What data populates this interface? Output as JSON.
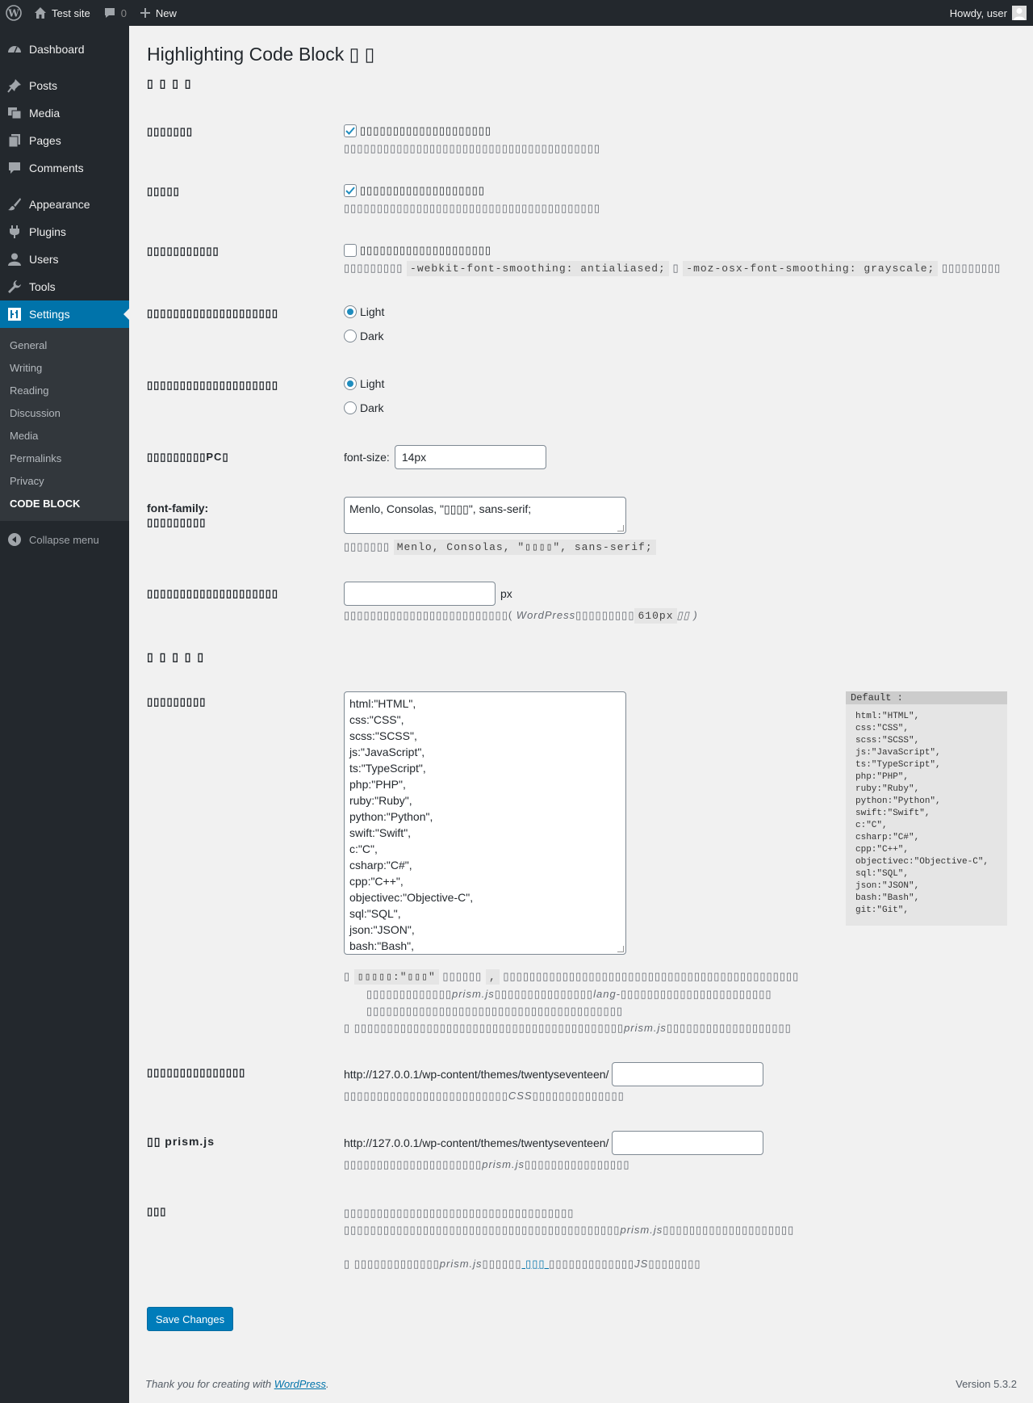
{
  "adminbar": {
    "site_name": "Test site",
    "comments_count": "0",
    "new_label": "New",
    "howdy": "Howdy, user"
  },
  "sidebar": {
    "items": [
      {
        "label": "Dashboard",
        "icon": "dashboard-icon"
      },
      {
        "label": "Posts",
        "icon": "pin-icon"
      },
      {
        "label": "Media",
        "icon": "media-icon"
      },
      {
        "label": "Pages",
        "icon": "page-icon"
      },
      {
        "label": "Comments",
        "icon": "comment-icon"
      },
      {
        "label": "Appearance",
        "icon": "brush-icon"
      },
      {
        "label": "Plugins",
        "icon": "plugin-icon"
      },
      {
        "label": "Users",
        "icon": "user-icon"
      },
      {
        "label": "Tools",
        "icon": "wrench-icon"
      },
      {
        "label": "Settings",
        "icon": "settings-icon"
      }
    ],
    "submenu": [
      "General",
      "Writing",
      "Reading",
      "Discussion",
      "Media",
      "Permalinks",
      "Privacy",
      "CODE BLOCK"
    ],
    "collapse_label": "Collapse menu"
  },
  "page": {
    "title": "Highlighting Code Block ▯ ▯",
    "section1": "▯ ▯ ▯ ▯",
    "section2": "▯ ▯ ▯ ▯ ▯"
  },
  "rows": {
    "r1": {
      "label": "▯▯▯▯▯▯▯",
      "checkbox_label": "▯▯▯▯▯▯▯▯▯▯▯▯▯▯▯▯▯▯▯▯",
      "desc": "▯▯▯▯▯▯▯▯▯▯▯▯▯▯▯▯▯▯▯▯▯▯▯▯▯▯▯▯▯▯▯▯▯▯▯▯▯▯▯",
      "checked": true
    },
    "r2": {
      "label": "▯▯▯▯▯",
      "checkbox_label": "▯▯▯▯▯▯▯▯▯▯▯▯▯▯▯▯▯▯▯",
      "desc": "▯▯▯▯▯▯▯▯▯▯▯▯▯▯▯▯▯▯▯▯▯▯▯▯▯▯▯▯▯▯▯▯▯▯▯▯▯▯▯",
      "checked": true
    },
    "r3": {
      "label": "▯▯▯▯▯▯▯▯▯▯▯",
      "checkbox_label": "▯▯▯▯▯▯▯▯▯▯▯▯▯▯▯▯▯▯▯▯",
      "desc_pre": "▯▯▯▯▯▯▯▯▯",
      "code1": "-webkit-font-smoothing: antialiased;",
      "desc_mid": "▯",
      "code2": "-moz-osx-font-smoothing: grayscale;",
      "desc_post": "▯▯▯▯▯▯▯▯▯",
      "checked": false
    },
    "r4": {
      "label": "▯▯▯▯▯▯▯▯▯▯▯▯▯▯▯▯▯▯▯▯",
      "opt1": "Light",
      "opt2": "Dark",
      "selected": "Light"
    },
    "r5": {
      "label": "▯▯▯▯▯▯▯▯▯▯▯▯▯▯▯▯▯▯▯▯",
      "opt1": "Light",
      "opt2": "Dark",
      "selected": "Light"
    },
    "r6": {
      "label": "▯▯▯▯▯▯▯▯▯PC▯",
      "prefix": "font-size:",
      "value": "14px"
    },
    "r7": {
      "label": "font-family:",
      "label2": "▯▯▯▯▯▯▯▯▯",
      "value": "Menlo, Consolas, \"▯▯▯▯\", sans-serif;",
      "desc_pre": "▯▯▯▯▯▯▯",
      "code": "Menlo, Consolas, \"▯▯▯▯\", sans-serif;"
    },
    "r8": {
      "label": "▯▯▯▯▯▯▯▯▯▯▯▯▯▯▯▯▯▯▯▯",
      "value": "",
      "unit": "px",
      "desc_pre": "▯▯▯▯▯▯▯▯▯▯▯▯▯▯▯▯▯▯▯▯▯▯▯▯▯( ",
      "desc_wp": "WordPress",
      "desc_mid": "▯▯▯▯▯▯▯▯▯",
      "code": "610px",
      "desc_post": "▯▯ )"
    },
    "r9": {
      "label": "▯▯▯▯▯▯▯▯▯",
      "languages": [
        "html:\"HTML\",",
        "css:\"CSS\",",
        "scss:\"SCSS\",",
        "js:\"JavaScript\",",
        "ts:\"TypeScript\",",
        "php:\"PHP\",",
        "ruby:\"Ruby\",",
        "python:\"Python\",",
        "swift:\"Swift\",",
        "c:\"C\",",
        "csharp:\"C#\",",
        "cpp:\"C++\",",
        "objectivec:\"Objective-C\",",
        "sql:\"SQL\",",
        "json:\"JSON\",",
        "bash:\"Bash\","
      ],
      "default_header": "Default :",
      "default_list": [
        "html:\"HTML\",",
        "css:\"CSS\",",
        "scss:\"SCSS\",",
        "js:\"JavaScript\",",
        "ts:\"TypeScript\",",
        "php:\"PHP\",",
        "ruby:\"Ruby\",",
        "python:\"Python\",",
        "swift:\"Swift\",",
        "c:\"C\",",
        "csharp:\"C#\",",
        "cpp:\"C++\",",
        "objectivec:\"Objective-C\",",
        "sql:\"SQL\",",
        "json:\"JSON\",",
        "bash:\"Bash\",",
        "git:\"Git\","
      ],
      "note1_pre": "▯ ",
      "note1_code": "▯▯▯▯▯:\"▯▯▯\"",
      "note1_mid": " ▯▯▯▯▯▯ ",
      "note1_code2": ",",
      "note1_post": " ▯▯▯▯▯▯▯▯▯▯▯▯▯▯▯▯▯▯▯▯▯▯▯▯▯▯▯▯▯▯▯▯▯▯▯▯▯▯▯▯▯▯▯▯▯",
      "note2_pre": "▯▯▯▯▯▯▯▯▯▯▯▯▯",
      "note2_i": "prism.js",
      "note2_mid": "▯▯▯▯▯▯▯▯▯▯▯▯▯▯▯",
      "note2_i2": "lang-",
      "note2_post": "▯▯▯▯▯▯▯▯▯▯▯▯▯▯▯▯▯▯▯▯▯▯▯",
      "note3": "▯▯▯▯▯▯▯▯▯▯▯▯▯▯▯▯▯▯▯▯▯▯▯▯▯▯▯▯▯▯▯▯▯▯▯▯▯▯▯",
      "note4_pre": "▯ ▯▯▯▯▯▯▯▯▯▯▯▯▯▯▯▯▯▯▯▯▯▯▯▯▯▯▯▯▯▯▯▯▯▯▯▯▯▯▯▯▯",
      "note4_i": "prism.js",
      "note4_post": "▯▯▯▯▯▯▯▯▯▯▯▯▯▯▯▯▯▯▯"
    },
    "r10": {
      "label": "▯▯▯▯▯▯▯▯▯▯▯▯▯▯▯",
      "url": "http://127.0.0.1/wp-content/themes/twentyseventeen/",
      "value": "",
      "desc_pre": "▯▯▯▯▯▯▯▯▯▯▯▯▯▯▯▯▯▯▯▯▯▯▯▯▯",
      "desc_i": "CSS",
      "desc_post": "▯▯▯▯▯▯▯▯▯▯▯▯▯▯"
    },
    "r11": {
      "label": "▯▯ prism.js",
      "url": "http://127.0.0.1/wp-content/themes/twentyseventeen/",
      "value": "",
      "desc_pre": "▯▯▯▯▯▯▯▯▯▯▯▯▯▯▯▯▯▯▯▯▯",
      "desc_i": "prism.js",
      "desc_post": "▯▯▯▯▯▯▯▯▯▯▯▯▯▯▯▯"
    },
    "r12": {
      "label": "▯▯▯",
      "line1": "▯▯▯▯▯▯▯▯▯▯▯▯▯▯▯▯▯▯▯▯▯▯▯▯▯▯▯▯▯▯▯▯▯▯▯",
      "line2_pre": "▯▯▯▯▯▯▯▯▯▯▯▯▯▯▯▯▯▯▯▯▯▯▯▯▯▯▯▯▯▯▯▯▯▯▯▯▯▯▯▯▯▯",
      "line2_i": "prism.js",
      "line2_post": "▯▯▯▯▯▯▯▯▯▯▯▯▯▯▯▯▯▯▯▯",
      "line3_pre": "▯ ▯▯▯▯▯▯▯▯▯▯▯▯▯",
      "line3_i": "prism.js",
      "line3_mid": "▯▯▯▯▯▯",
      "line3_link": " ▯▯▯ ",
      "line3_post": "▯▯▯▯▯▯▯▯▯▯▯▯▯",
      "line3_i2": "JS",
      "line3_end": "▯▯▯▯▯▯▯▯"
    }
  },
  "save_label": "Save Changes",
  "footer": {
    "thanks_pre": "Thank you for creating with ",
    "thanks_link": "WordPress",
    "thanks_post": ".",
    "version": "Version 5.3.2"
  },
  "colors": {
    "accent": "#0073aa",
    "sidebar_bg": "#23282d",
    "page_bg": "#f1f1f1"
  }
}
